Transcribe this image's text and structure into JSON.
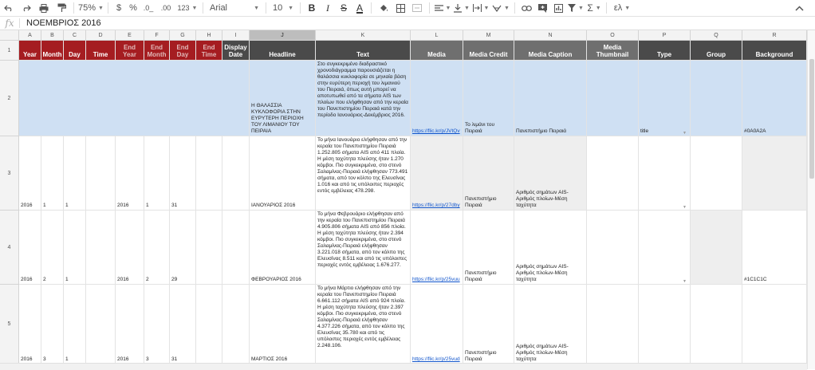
{
  "toolbar": {
    "zoom": "75%",
    "currency": "$",
    "percent": "%",
    "dec_less": ".0_",
    "dec_more": ".00",
    "format_123": "123",
    "font": "Arial",
    "font_size": "10",
    "bold": "B",
    "italic": "I",
    "strike": "S",
    "text_color": "A",
    "sigma": "Σ",
    "input_tools": "ελ"
  },
  "formula_bar": {
    "fx": "fx",
    "value": "ΝΟΕΜΒΡΙΟΣ 2016"
  },
  "columns": [
    "A",
    "B",
    "C",
    "D",
    "E",
    "F",
    "G",
    "H",
    "I",
    "J",
    "K",
    "L",
    "M",
    "N",
    "O",
    "P",
    "Q",
    "R"
  ],
  "headers": {
    "year": "Year",
    "month": "Month",
    "day": "Day",
    "time": "Time",
    "end_year": "End Year",
    "end_month": "End Month",
    "end_day": "End Day",
    "end_time": "End Time",
    "display_date": "Display Date",
    "headline": "Headline",
    "text": "Text",
    "media": "Media",
    "media_credit": "Media Credit",
    "media_caption": "Media Caption",
    "media_thumbnail": "Media Thumbnail",
    "type": "Type",
    "group": "Group",
    "background": "Background"
  },
  "row_numbers": [
    "1",
    "2",
    "3",
    "4",
    "5"
  ],
  "rows": [
    {
      "headline": "Η ΘΑΛΑΣΣΙΑ ΚΥΚΛΟΦΟΡΙΑ ΣΤΗΝ ΕΥΡΥΤΕΡΗ ΠΕΡΙΟΧΗ ΤΟΥ ΛΙΜΑΝΙΟΥ ΤΟΥ ΠΕΙΡΑΙΑ",
      "text": "Στο συγκεκριμένο διαδραστικό χρονοδιάγραμμα παρουσιάζεται η θαλάσσια κυκλοφορία σε μηνιαία βάση στην ευρύτερη περιοχή του λιμανιού του Πειραιά, όπως αυτή μπορεί να αποτυπωθεί από τα σήματα AIS των πλοίων που ελήφθησαν από την κεραία του Πανεπιστημίου Πειραιά κατά την περίοδο Ιανουάριος-Δεκέμβριος 2016.",
      "media": "https://flic.kr/p/JVtQv",
      "media_credit": "Το λιμάνι του Πειραιά",
      "media_caption": "Πανεπιστήμιο Πειραιά",
      "type": "title",
      "background": "#0A0A2A"
    },
    {
      "year": "2016",
      "month": "1",
      "day": "1",
      "end_year": "2016",
      "end_month": "1",
      "end_day": "31",
      "headline": "ΙΑΝΟΥΑΡΙΟΣ 2016",
      "text": "Το μήνα Ιανουάριο ελήφθησαν από την κεραία του Πανεπιστημίου Πειραιά 1.252.805 σήματα AIS από 411 πλοία. Η μέση ταχύτητα πλεύσης ήταν 1.270 κόμβοι. Πιο συγκεκριμένα, στο στενό Σαλαμίνας-Πειραιά ελήφθησαν 773.491 σήματα, από τον κόλπο της Ελευσίνας 1.016 και από τις υπόλοιπες περιοχές εντός εμβέλειας 478.298.",
      "media": "https://flic.kr/p/27dby",
      "media_credit": "Πανεπιστήμιο Πειραιά",
      "media_caption": "Αριθμός σημάτων AIS-Αριθμός πλοίων-Μέση ταχύτητα",
      "type": "",
      "background": ""
    },
    {
      "year": "2016",
      "month": "2",
      "day": "1",
      "end_year": "2016",
      "end_month": "2",
      "end_day": "29",
      "headline": "ΦΕΒΡΟΥΑΡΙΟΣ 2016",
      "text": "Το μήνα Φεβρουάριο ελήφθησαν από την κεραία του Πανεπιστημίου Πειραιά 4.905.806 σήματα AIS από 856 πλοία. Η μέση ταχύτητα πλεύσης ήταν 2.394 κόμβοι. Πιο συγκεκριμένα, στο στενό Σαλαμίνας-Πειραιά ελήφθησαν 3.221.018 σήματα, από τον κόλπο της Ελευσίνας 8.511 και από τις υπόλοιπες περιοχές εντός εμβέλειας 1.676.277.",
      "media": "https://flic.kr/p/25vuu",
      "media_credit": "Πανεπιστήμιο Πειραιά",
      "media_caption": "Αριθμός σημάτων AIS-Αριθμός πλοίων-Μέση ταχύτητα",
      "type": "",
      "background": "#1C1C1C"
    },
    {
      "year": "2016",
      "month": "3",
      "day": "1",
      "end_year": "2016",
      "end_month": "3",
      "end_day": "31",
      "headline": "ΜΑΡΤΙΟΣ 2016",
      "text": "Το μήνα Μάρτιο ελήφθησαν από την κεραία του Πανεπιστημίου Πειραιά 6.661.112 σήματα AIS από 924 πλοία. Η μέση ταχύτητα πλεύσης ήταν 2.397 κόμβοι. Πιο συγκεκριμένα, στο στενό Σαλαμίνας-Πειραιά ελήφθησαν 4.377.226 σήματα, από τον κόλπο της Ελευσίνας 35.780 και από τις υπόλοιπες περιοχές εντός εμβέλειας 2.248.106.",
      "media": "https://flic.kr/p/25vud",
      "media_credit": "Πανεπιστήμιο Πειραιά",
      "media_caption": "Αριθμός σημάτων AIS-Αριθμός πλοίων-Μέση ταχύτητα",
      "type": "",
      "background": ""
    }
  ],
  "colors": {
    "header_red": "#a51d21",
    "header_dark": "#4a4a4a",
    "header_mid": "#6f6f6f",
    "selected_row": "#cfe0f3",
    "link": "#1155cc"
  }
}
